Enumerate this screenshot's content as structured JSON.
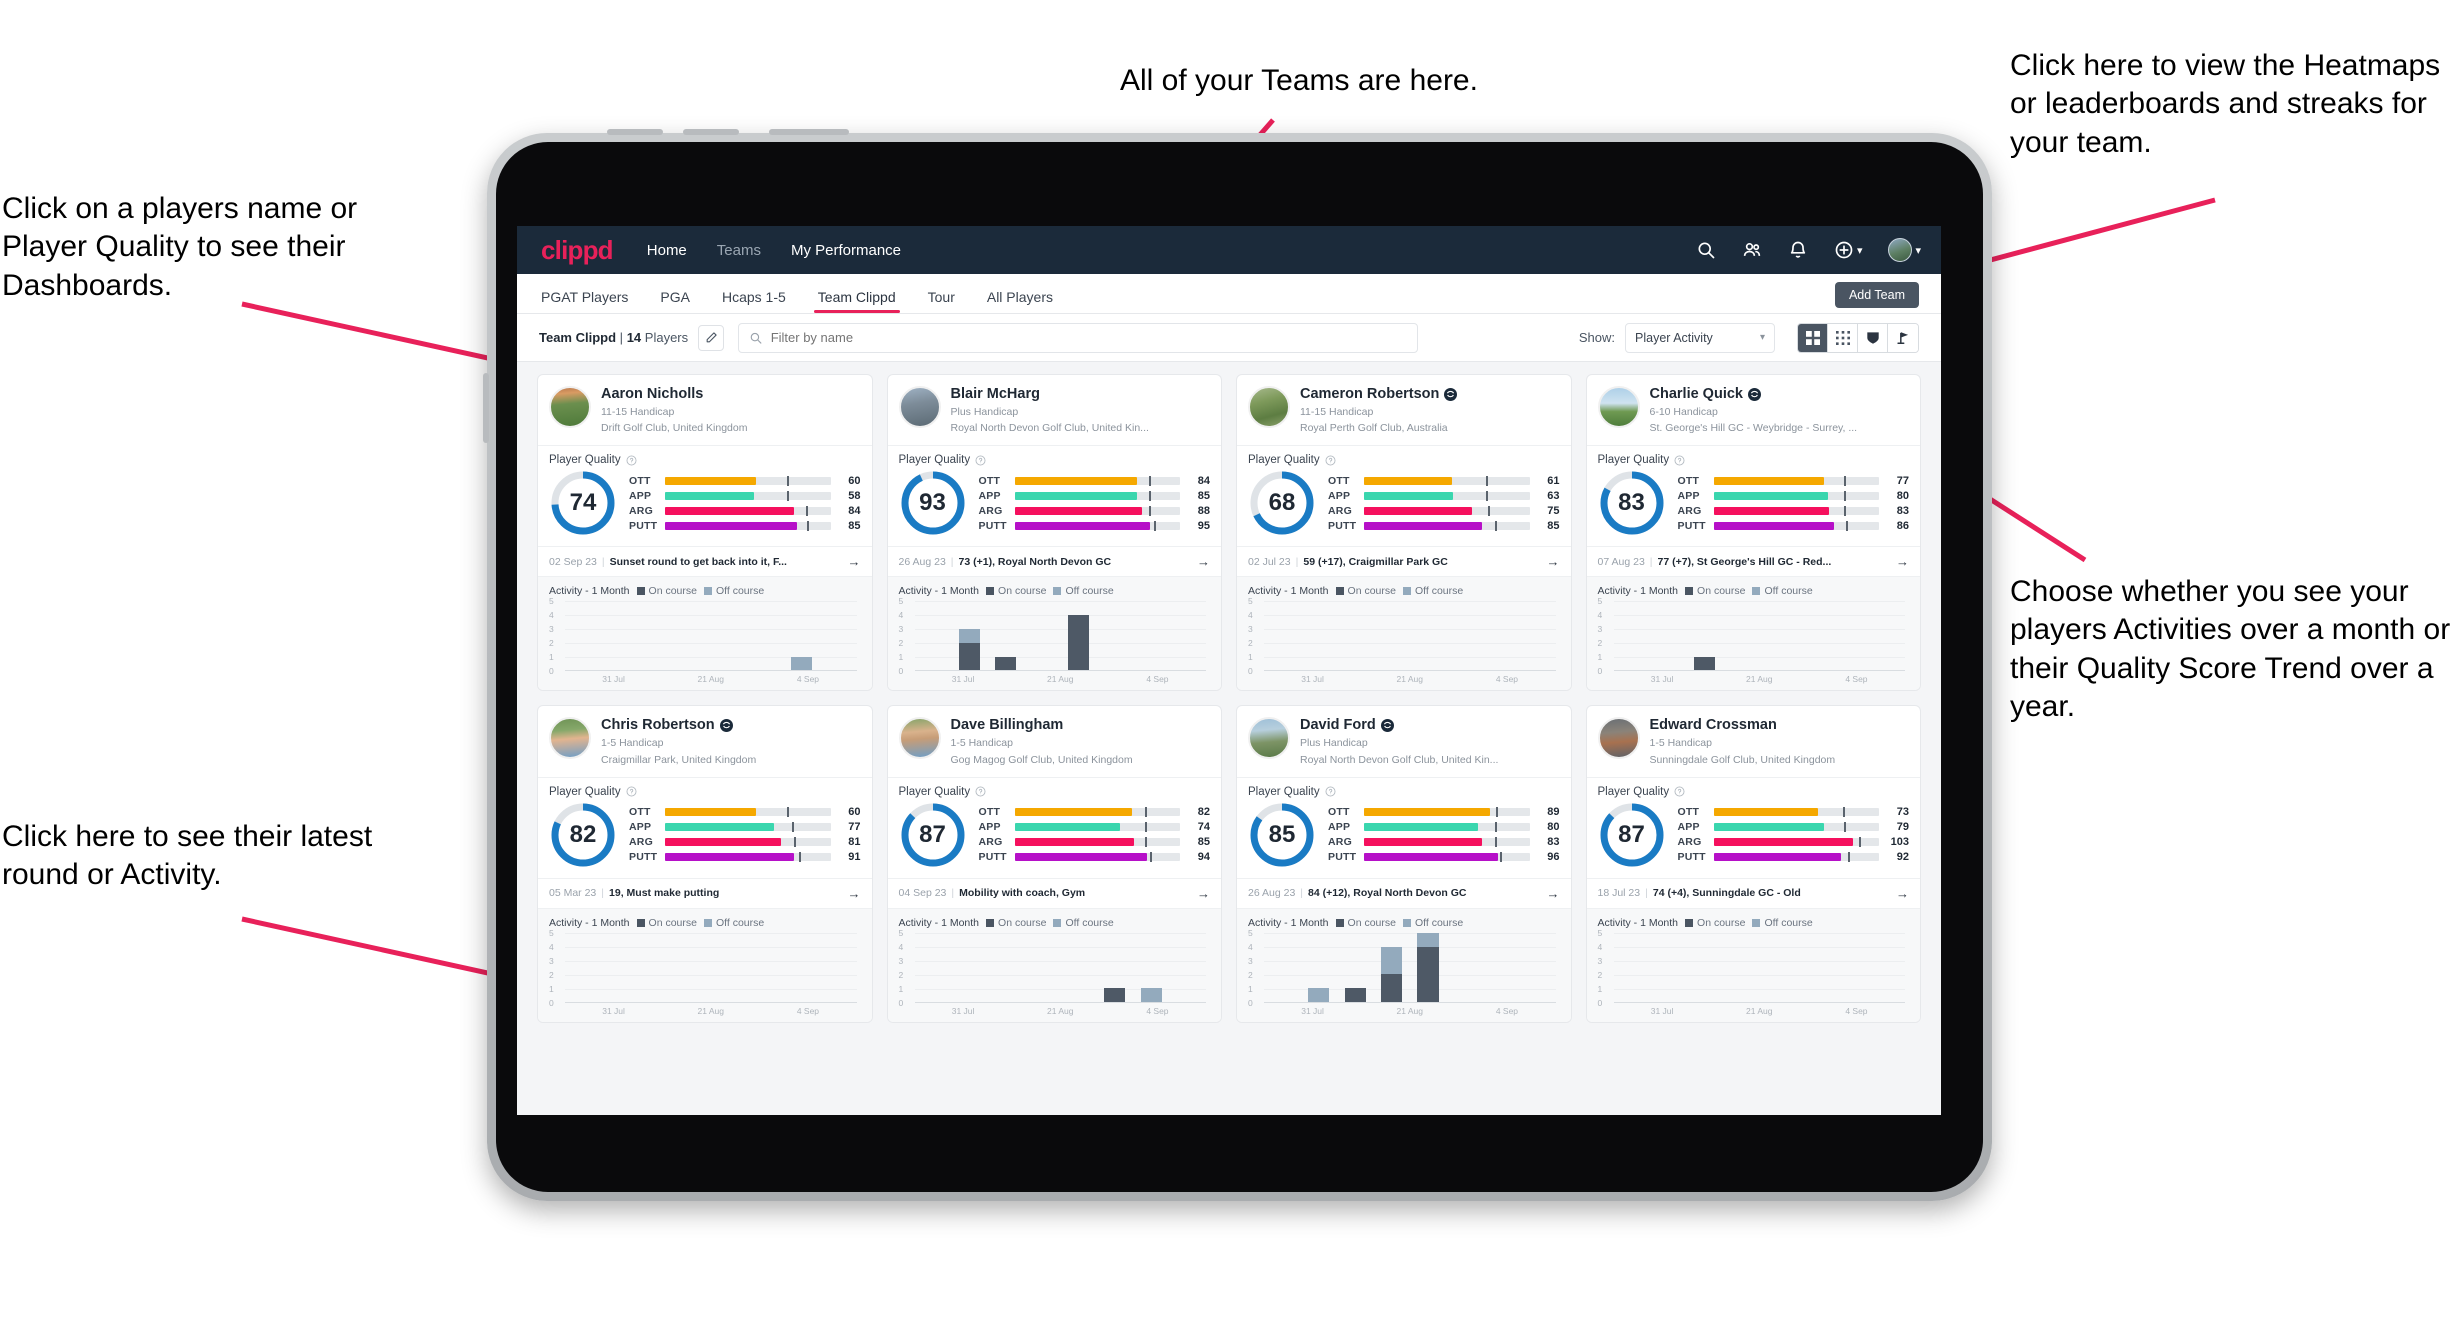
{
  "annotations": [
    {
      "id": "anno-left-top",
      "text": "Click on a players name or Player Quality to see their Dashboards."
    },
    {
      "id": "anno-left-bot",
      "text": "Click here to see their latest round or Activity."
    },
    {
      "id": "anno-top",
      "text": "All of your Teams are here."
    },
    {
      "id": "anno-right-top",
      "text": "Click here to view the Heatmaps or leaderboards and streaks for your team."
    },
    {
      "id": "anno-right-bot",
      "text": "Choose whether you see your players Activities over a month or their Quality Score Trend over a year."
    }
  ],
  "colors": {
    "accent": "#e8215a",
    "navbar": "#1b2a3a",
    "ott": "#f5a800",
    "app": "#3ad6ae",
    "arg": "#f5105e",
    "putt": "#b610c8",
    "donut": "#1a7bc4",
    "donut_track": "#dfe3e7",
    "on_course": "#4e5966",
    "off_course": "#93aabd"
  },
  "topbar": {
    "brand": "clippd",
    "links": [
      {
        "label": "Home",
        "active": true
      },
      {
        "label": "Teams",
        "active": false
      },
      {
        "label": "My Performance",
        "active": false
      }
    ],
    "icons": [
      "search-icon",
      "people-icon",
      "bell-icon",
      "plus-circle-icon",
      "avatar"
    ]
  },
  "tabs": [
    {
      "label": "PGAT Players",
      "active": false
    },
    {
      "label": "PGA",
      "active": false
    },
    {
      "label": "Hcaps 1-5",
      "active": false
    },
    {
      "label": "Team Clippd",
      "active": true
    },
    {
      "label": "Tour",
      "active": false
    },
    {
      "label": "All Players",
      "active": false
    }
  ],
  "add_team_label": "Add Team",
  "toolbar": {
    "team_name": "Team Clippd",
    "separator": "|",
    "player_count": "14",
    "players_word": "Players",
    "edit_icon": "pencil-icon",
    "search_placeholder": "Filter by name",
    "search_value": "",
    "show_label": "Show:",
    "show_value": "Player Activity",
    "show_options": [
      "Player Activity",
      "Quality Score Trend"
    ],
    "views": [
      {
        "name": "large-grid-view",
        "active": true
      },
      {
        "name": "compact-grid-view",
        "active": false
      },
      {
        "name": "leaderboard-view",
        "active": false
      },
      {
        "name": "course-view",
        "active": false
      }
    ]
  },
  "card_labels": {
    "player_quality": "Player Quality",
    "activity": "Activity - 1 Month",
    "on_course": "On course",
    "off_course": "Off course",
    "metric_names": [
      "OTT",
      "APP",
      "ARG",
      "PUTT"
    ],
    "y_ticks": [
      "5",
      "4",
      "3",
      "2",
      "1",
      "0"
    ],
    "x_ticks": [
      "31 Jul",
      "21 Aug",
      "4 Sep"
    ]
  },
  "players": [
    {
      "name": "Aaron Nicholls",
      "verified": false,
      "handicap": "11-15 Handicap",
      "club": "Drift Golf Club, United Kingdom",
      "quality": 74,
      "metrics": [
        {
          "label": "OTT",
          "value": 60,
          "fill": 55,
          "tick": 74
        },
        {
          "label": "APP",
          "value": 58,
          "fill": 54,
          "tick": 74
        },
        {
          "label": "ARG",
          "value": 84,
          "fill": 78,
          "tick": 85
        },
        {
          "label": "PUTT",
          "value": 85,
          "fill": 80,
          "tick": 86
        }
      ],
      "round_date": "02 Sep 23",
      "round_text": "Sunset round to get back into it, F...",
      "activity": [
        {
          "on": 0,
          "off": 0
        },
        {
          "on": 0,
          "off": 0
        },
        {
          "on": 0,
          "off": 0
        },
        {
          "on": 0,
          "off": 0
        },
        {
          "on": 0,
          "off": 0
        },
        {
          "on": 0,
          "off": 0
        },
        {
          "on": 0,
          "off": 1
        },
        {
          "on": 0,
          "off": 0
        }
      ],
      "avatar_css": "linear-gradient(175deg,#b9794e 0%,#d99b63 16%,#6b8f4e 42%,#4e7a3a 100%)"
    },
    {
      "name": "Blair McHarg",
      "verified": false,
      "handicap": "Plus Handicap",
      "club": "Royal North Devon Golf Club, United Kin...",
      "quality": 93,
      "metrics": [
        {
          "label": "OTT",
          "value": 84,
          "fill": 74,
          "tick": 81
        },
        {
          "label": "APP",
          "value": 85,
          "fill": 74,
          "tick": 81
        },
        {
          "label": "ARG",
          "value": 88,
          "fill": 77,
          "tick": 81
        },
        {
          "label": "PUTT",
          "value": 95,
          "fill": 82,
          "tick": 84
        }
      ],
      "round_date": "26 Aug 23",
      "round_text": "73 (+1), Royal North Devon GC",
      "activity": [
        {
          "on": 0,
          "off": 0
        },
        {
          "on": 2,
          "off": 1
        },
        {
          "on": 1,
          "off": 0
        },
        {
          "on": 0,
          "off": 0
        },
        {
          "on": 4,
          "off": 0
        },
        {
          "on": 0,
          "off": 0
        },
        {
          "on": 0,
          "off": 0
        },
        {
          "on": 0,
          "off": 0
        }
      ],
      "avatar_css": "linear-gradient(170deg,#9fb2c4 0%,#7d8c99 40%,#5b6a74 100%)"
    },
    {
      "name": "Cameron Robertson",
      "verified": true,
      "handicap": "11-15 Handicap",
      "club": "Royal Perth Golf Club, Australia",
      "quality": 68,
      "metrics": [
        {
          "label": "OTT",
          "value": 61,
          "fill": 53,
          "tick": 74
        },
        {
          "label": "APP",
          "value": 63,
          "fill": 54,
          "tick": 74
        },
        {
          "label": "ARG",
          "value": 75,
          "fill": 65,
          "tick": 75
        },
        {
          "label": "PUTT",
          "value": 85,
          "fill": 71,
          "tick": 79
        }
      ],
      "round_date": "02 Jul 23",
      "round_text": "59 (+17), Craigmillar Park GC",
      "activity": [
        {
          "on": 0,
          "off": 0
        },
        {
          "on": 0,
          "off": 0
        },
        {
          "on": 0,
          "off": 0
        },
        {
          "on": 0,
          "off": 0
        },
        {
          "on": 0,
          "off": 0
        },
        {
          "on": 0,
          "off": 0
        },
        {
          "on": 0,
          "off": 0
        },
        {
          "on": 0,
          "off": 0
        }
      ],
      "avatar_css": "linear-gradient(165deg,#a7b98c 0%,#7e9a5b 35%,#5d7d42 70%,#8aa06a 100%)"
    },
    {
      "name": "Charlie Quick",
      "verified": true,
      "handicap": "6-10 Handicap",
      "club": "St. George's Hill GC - Weybridge - Surrey, ...",
      "quality": 83,
      "metrics": [
        {
          "label": "OTT",
          "value": 77,
          "fill": 67,
          "tick": 79
        },
        {
          "label": "APP",
          "value": 80,
          "fill": 69,
          "tick": 79
        },
        {
          "label": "ARG",
          "value": 83,
          "fill": 70,
          "tick": 79
        },
        {
          "label": "PUTT",
          "value": 86,
          "fill": 73,
          "tick": 80
        }
      ],
      "round_date": "07 Aug 23",
      "round_text": "77 (+7), St George's Hill GC - Red...",
      "activity": [
        {
          "on": 0,
          "off": 0
        },
        {
          "on": 0,
          "off": 0
        },
        {
          "on": 1,
          "off": 0
        },
        {
          "on": 0,
          "off": 0
        },
        {
          "on": 0,
          "off": 0
        },
        {
          "on": 0,
          "off": 0
        },
        {
          "on": 0,
          "off": 0
        },
        {
          "on": 0,
          "off": 0
        }
      ],
      "avatar_css": "linear-gradient(180deg,#aed0e8 0%,#cfe3f0 40%,#6f9a52 62%,#4f7e3c 100%)"
    },
    {
      "name": "Chris Robertson",
      "verified": true,
      "handicap": "1-5 Handicap",
      "club": "Craigmillar Park, United Kingdom",
      "quality": 82,
      "metrics": [
        {
          "label": "OTT",
          "value": 60,
          "fill": 55,
          "tick": 74
        },
        {
          "label": "APP",
          "value": 77,
          "fill": 66,
          "tick": 77
        },
        {
          "label": "ARG",
          "value": 81,
          "fill": 70,
          "tick": 78
        },
        {
          "label": "PUTT",
          "value": 91,
          "fill": 78,
          "tick": 81
        }
      ],
      "round_date": "05 Mar 23",
      "round_text": "19, Must make putting",
      "activity": [
        {
          "on": 0,
          "off": 0
        },
        {
          "on": 0,
          "off": 0
        },
        {
          "on": 0,
          "off": 0
        },
        {
          "on": 0,
          "off": 0
        },
        {
          "on": 0,
          "off": 0
        },
        {
          "on": 0,
          "off": 0
        },
        {
          "on": 0,
          "off": 0
        },
        {
          "on": 0,
          "off": 0
        }
      ],
      "avatar_css": "linear-gradient(175deg,#6f9356 0%,#86a86a 30%,#e2b48f 52%,#6f9ec7 100%)"
    },
    {
      "name": "Dave Billingham",
      "verified": false,
      "handicap": "1-5 Handicap",
      "club": "Gog Magog Golf Club, United Kingdom",
      "quality": 87,
      "metrics": [
        {
          "label": "OTT",
          "value": 82,
          "fill": 71,
          "tick": 79
        },
        {
          "label": "APP",
          "value": 74,
          "fill": 64,
          "tick": 79
        },
        {
          "label": "ARG",
          "value": 85,
          "fill": 72,
          "tick": 79
        },
        {
          "label": "PUTT",
          "value": 94,
          "fill": 80,
          "tick": 82
        }
      ],
      "round_date": "04 Sep 23",
      "round_text": "Mobility with coach, Gym",
      "activity": [
        {
          "on": 0,
          "off": 0
        },
        {
          "on": 0,
          "off": 0
        },
        {
          "on": 0,
          "off": 0
        },
        {
          "on": 0,
          "off": 0
        },
        {
          "on": 0,
          "off": 0
        },
        {
          "on": 1,
          "off": 0
        },
        {
          "on": 0,
          "off": 1
        },
        {
          "on": 0,
          "off": 0
        }
      ],
      "avatar_css": "linear-gradient(175deg,#86a46a 0%,#d9b28c 34%,#c79d77 52%,#6f9ec7 100%)"
    },
    {
      "name": "David Ford",
      "verified": true,
      "handicap": "Plus Handicap",
      "club": "Royal North Devon Golf Club, United Kin...",
      "quality": 85,
      "metrics": [
        {
          "label": "OTT",
          "value": 89,
          "fill": 76,
          "tick": 80
        },
        {
          "label": "APP",
          "value": 80,
          "fill": 69,
          "tick": 79
        },
        {
          "label": "ARG",
          "value": 83,
          "fill": 71,
          "tick": 79
        },
        {
          "label": "PUTT",
          "value": 96,
          "fill": 81,
          "tick": 82
        }
      ],
      "round_date": "26 Aug 23",
      "round_text": "84 (+12), Royal North Devon GC",
      "activity": [
        {
          "on": 0,
          "off": 0
        },
        {
          "on": 0,
          "off": 1
        },
        {
          "on": 1,
          "off": 0
        },
        {
          "on": 2,
          "off": 2
        },
        {
          "on": 4,
          "off": 1
        },
        {
          "on": 0,
          "off": 0
        },
        {
          "on": 0,
          "off": 0
        },
        {
          "on": 0,
          "off": 0
        }
      ],
      "avatar_css": "linear-gradient(175deg,#9fc0d8 0%,#b7cfdd 30%,#7d9466 60%,#5a7a48 100%)"
    },
    {
      "name": "Edward Crossman",
      "verified": false,
      "handicap": "1-5 Handicap",
      "club": "Sunningdale Golf Club, United Kingdom",
      "quality": 87,
      "metrics": [
        {
          "label": "OTT",
          "value": 73,
          "fill": 63,
          "tick": 78
        },
        {
          "label": "APP",
          "value": 79,
          "fill": 67,
          "tick": 79
        },
        {
          "label": "ARG",
          "value": 103,
          "fill": 84,
          "tick": 88
        },
        {
          "label": "PUTT",
          "value": 92,
          "fill": 77,
          "tick": 81
        }
      ],
      "round_date": "18 Jul 23",
      "round_text": "74 (+4), Sunningdale GC - Old",
      "activity": [
        {
          "on": 0,
          "off": 0
        },
        {
          "on": 0,
          "off": 0
        },
        {
          "on": 0,
          "off": 0
        },
        {
          "on": 0,
          "off": 0
        },
        {
          "on": 0,
          "off": 0
        },
        {
          "on": 0,
          "off": 0
        },
        {
          "on": 0,
          "off": 0
        },
        {
          "on": 0,
          "off": 0
        }
      ],
      "avatar_css": "linear-gradient(175deg,#6a6f74 0%,#8b8379 35%,#a8714f 60%,#5e6268 100%)"
    }
  ]
}
